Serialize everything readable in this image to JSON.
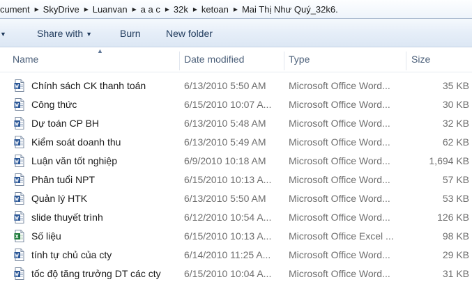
{
  "breadcrumb": [
    "cument",
    "SkyDrive",
    "Luanvan",
    "a a c",
    "32k",
    "ketoan",
    "Mai Thị Như Quý_32k6."
  ],
  "toolbar": {
    "share_label": "Share with",
    "burn_label": "Burn",
    "new_folder_label": "New folder"
  },
  "columns": {
    "name": "Name",
    "date": "Date modified",
    "type": "Type",
    "size": "Size"
  },
  "files": [
    {
      "name": "Chính sách CK thanh toán",
      "date": "6/13/2010 5:50 AM",
      "type": "Microsoft Office Word...",
      "size": "35 KB",
      "icon": "word-doc-icon"
    },
    {
      "name": "Công thức",
      "date": "6/15/2010 10:07 A...",
      "type": "Microsoft Office Word...",
      "size": "30 KB",
      "icon": "word-doc-icon"
    },
    {
      "name": "Dự toán CP BH",
      "date": "6/13/2010 5:48 AM",
      "type": "Microsoft Office Word...",
      "size": "32 KB",
      "icon": "word-doc-icon"
    },
    {
      "name": "Kiểm soát doanh thu",
      "date": "6/13/2010 5:49 AM",
      "type": "Microsoft Office Word...",
      "size": "62 KB",
      "icon": "word-doc-icon"
    },
    {
      "name": "Luận văn tốt nghiệp",
      "date": "6/9/2010 10:18 AM",
      "type": "Microsoft Office Word...",
      "size": "1,694 KB",
      "icon": "word-doc-icon"
    },
    {
      "name": "Phân tuổi NPT",
      "date": "6/15/2010 10:13 A...",
      "type": "Microsoft Office Word...",
      "size": "57 KB",
      "icon": "word-doc-icon"
    },
    {
      "name": "Quản lý HTK",
      "date": "6/13/2010 5:50 AM",
      "type": "Microsoft Office Word...",
      "size": "53 KB",
      "icon": "word-doc-icon"
    },
    {
      "name": "slide thuyết trình",
      "date": "6/12/2010 10:54 A...",
      "type": "Microsoft Office Word...",
      "size": "126 KB",
      "icon": "word-doc-icon"
    },
    {
      "name": "Số liệu",
      "date": "6/15/2010 10:13 A...",
      "type": "Microsoft Office Excel ...",
      "size": "98 KB",
      "icon": "excel-sheet-icon"
    },
    {
      "name": "tính tự chủ của cty",
      "date": "6/14/2010 11:25 A...",
      "type": "Microsoft Office Word...",
      "size": "29 KB",
      "icon": "word-doc-icon"
    },
    {
      "name": "tốc độ tăng trưởng DT các cty",
      "date": "6/15/2010 10:04 A...",
      "type": "Microsoft Office Word...",
      "size": "31 KB",
      "icon": "word-doc-icon"
    }
  ],
  "colors": {
    "word_icon": "#2b5797",
    "excel_icon": "#1d7a3a",
    "toolbar_text": "#1e395b"
  }
}
